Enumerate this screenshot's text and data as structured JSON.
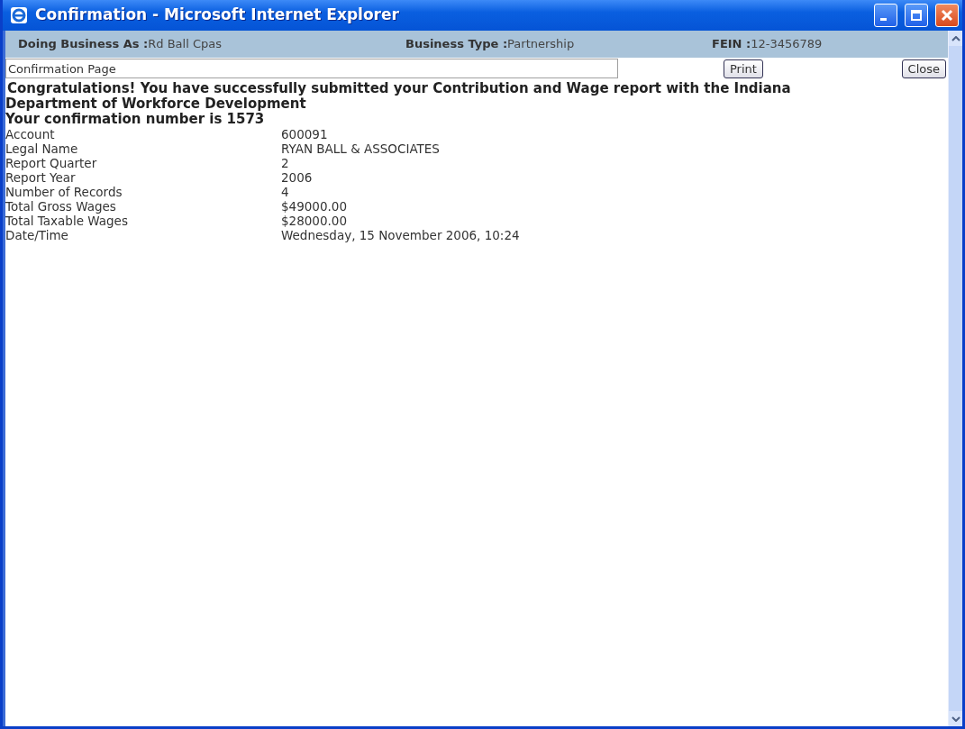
{
  "window": {
    "title": "Confirmation - Microsoft Internet Explorer"
  },
  "header": [
    {
      "label": "Doing Business As :",
      "value": "Rd Ball Cpas"
    },
    {
      "label": "Business Type :",
      "value": "Partnership"
    },
    {
      "label": "FEIN :",
      "value": "12-3456789"
    }
  ],
  "page_field": {
    "value": "Confirmation Page"
  },
  "buttons": [
    "Print",
    "Close"
  ],
  "message": [
    "Congratulations! You have successfully submitted your Contribution and Wage report with the Indiana Department of Workforce Development",
    "Your confirmation number is 1573"
  ],
  "details": [
    {
      "label": "Account",
      "value": "600091"
    },
    {
      "label": "Legal Name",
      "value": "RYAN BALL & ASSOCIATES"
    },
    {
      "label": "Report Quarter",
      "value": "2"
    },
    {
      "label": "Report Year",
      "value": "2006"
    },
    {
      "label": "Number of Records",
      "value": "4"
    },
    {
      "label": "Total Gross Wages",
      "value": "$49000.00"
    },
    {
      "label": "Total Taxable Wages",
      "value": "$28000.00"
    },
    {
      "label": "Date/Time",
      "value": "Wednesday, 15 November 2006, 10:24"
    }
  ]
}
